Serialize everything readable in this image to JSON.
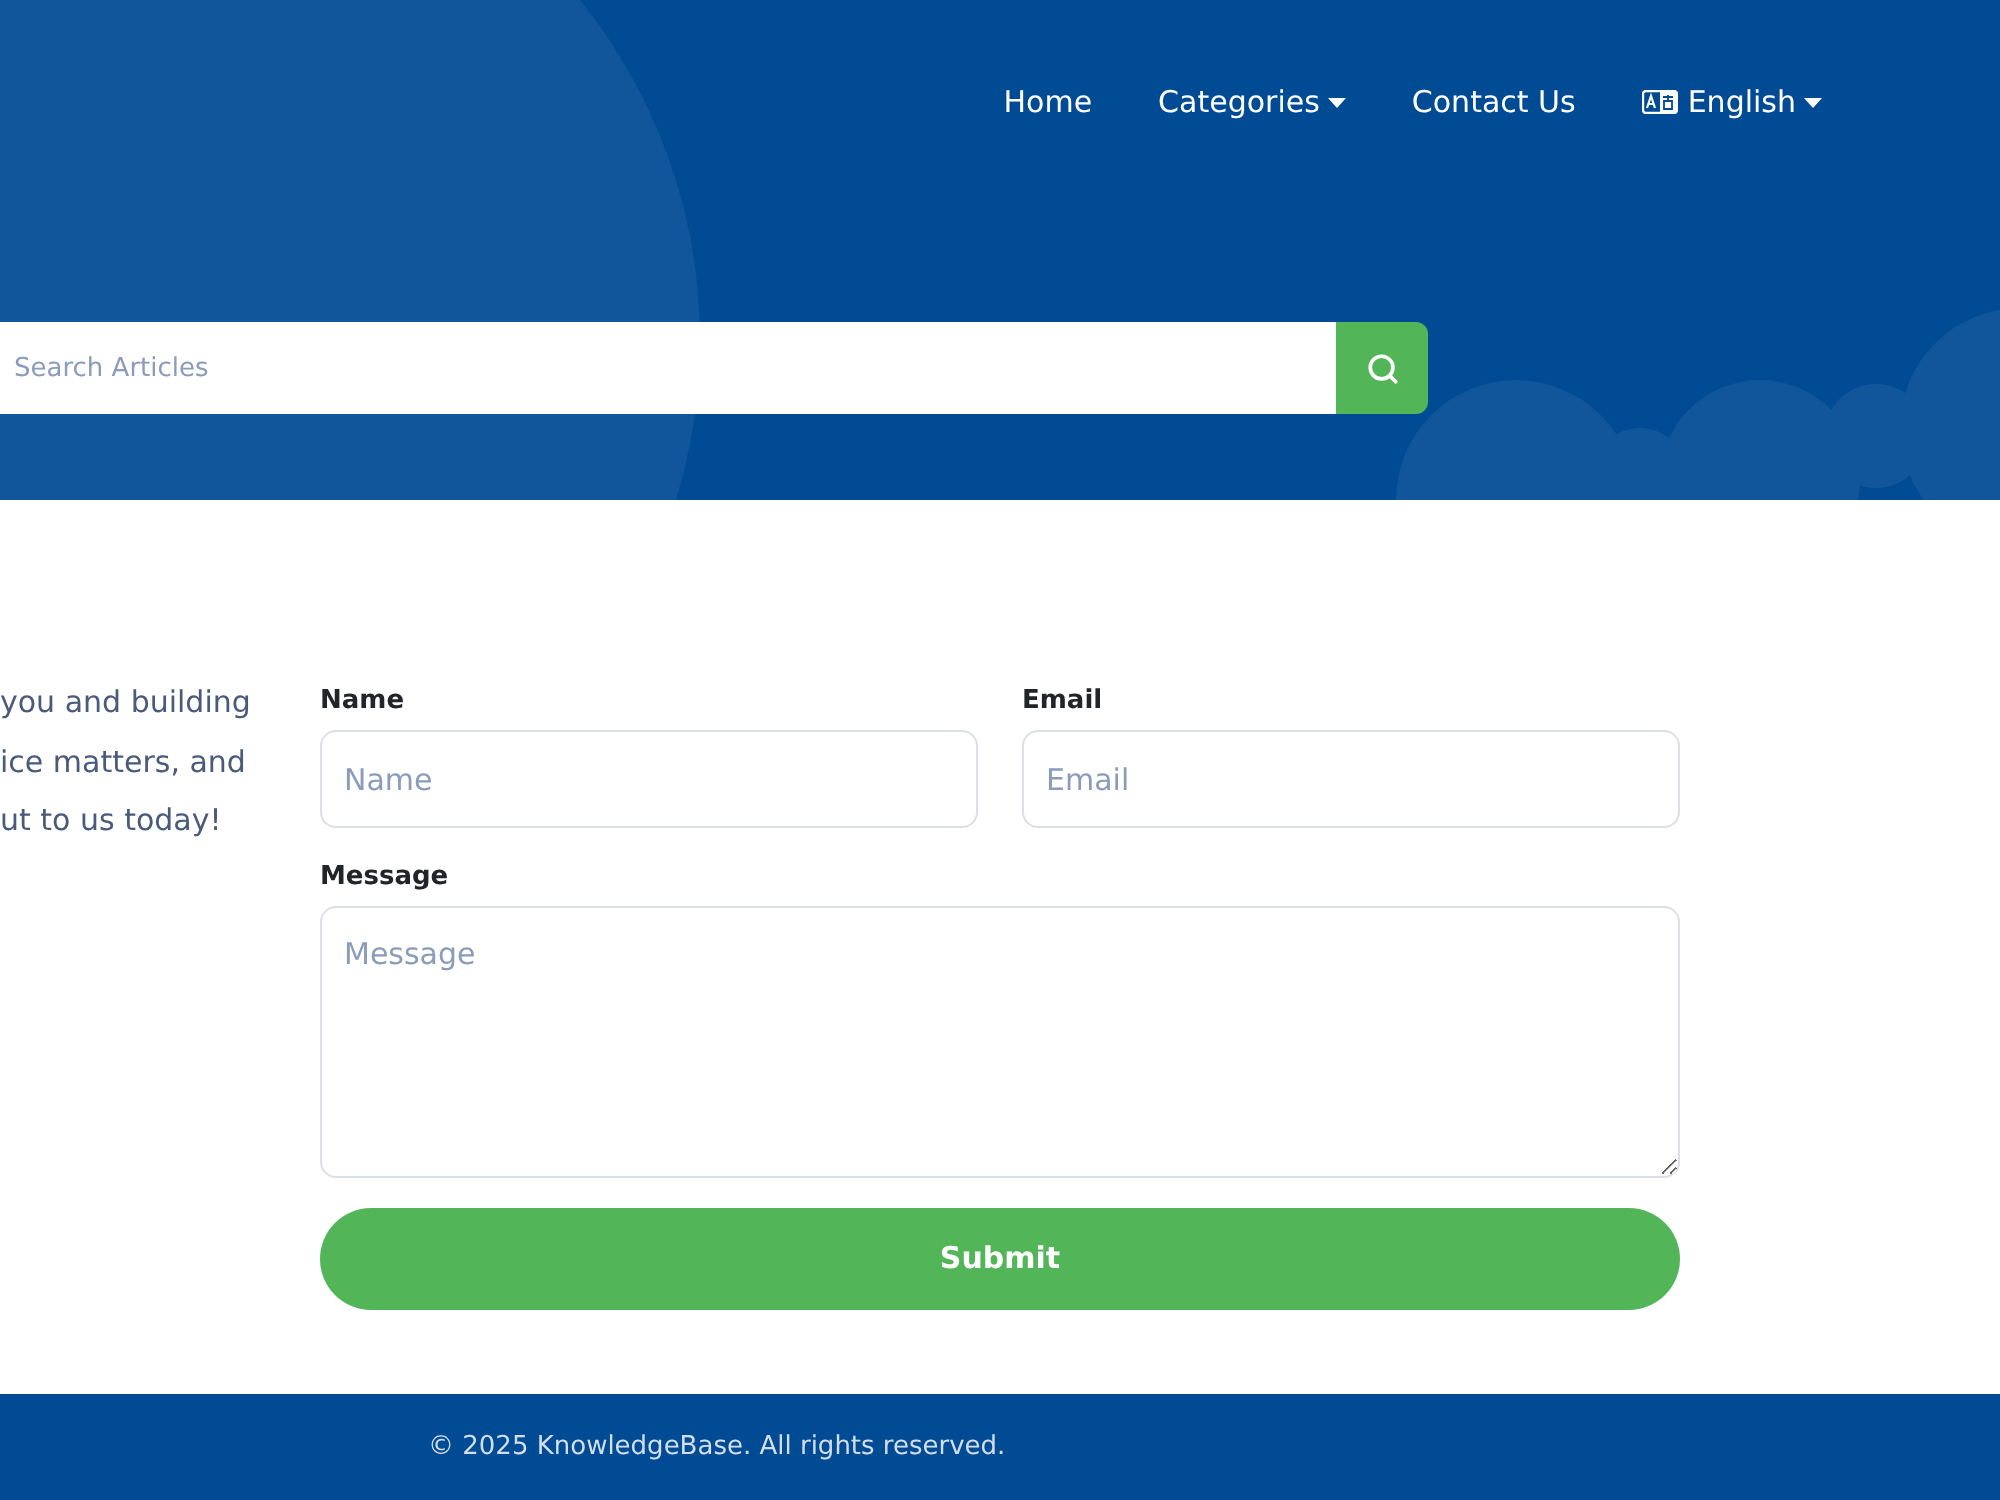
{
  "nav": {
    "items": [
      {
        "label": "Home",
        "kind": "link"
      },
      {
        "label": "Categories",
        "kind": "dropdown"
      },
      {
        "label": "Contact Us",
        "kind": "link"
      },
      {
        "label": "English",
        "kind": "language"
      }
    ]
  },
  "search": {
    "placeholder": "Search Articles"
  },
  "intro": {
    "lines": [
      "you and building",
      "ice matters, and",
      "ut to us today!"
    ]
  },
  "form": {
    "fields": [
      {
        "label": "Name",
        "placeholder": "Name",
        "kind": "input"
      },
      {
        "label": "Email",
        "placeholder": "Email",
        "kind": "input"
      },
      {
        "label": "Message",
        "placeholder": "Message",
        "kind": "textarea"
      }
    ],
    "submit": "Submit"
  },
  "footer": {
    "text": "© 2025 KnowledgeBase. All rights reserved."
  }
}
